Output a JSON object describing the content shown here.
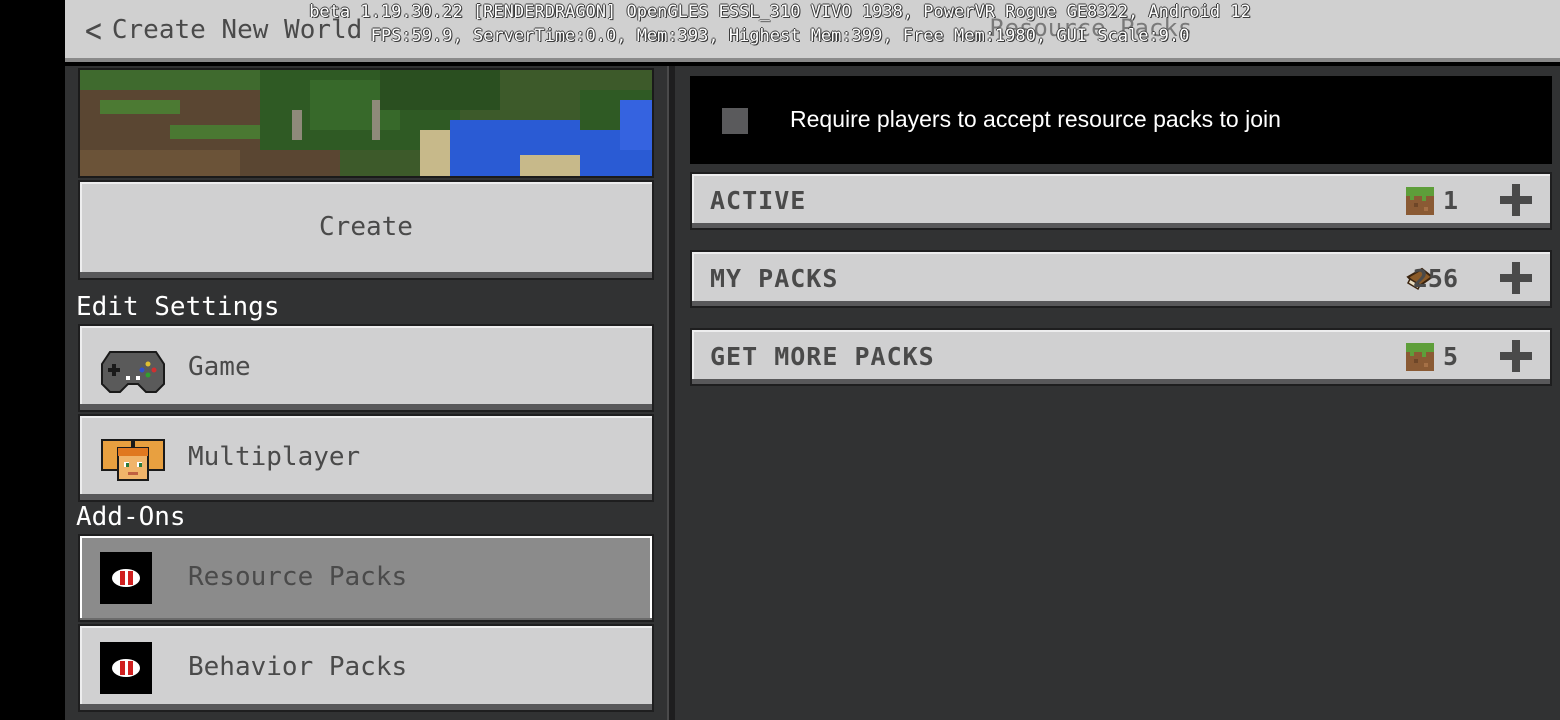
{
  "header": {
    "back_label": "Create New World",
    "panel_title": "Resource Packs"
  },
  "debug": {
    "line1": "beta 1.19.30.22 [RENDERDRAGON] OpenGLES ESSL_310 VIVO 1938, PowerVR Rogue GE8322, Android 12",
    "line2": "FPS:59.9, ServerTime:0.0, Mem:393, Highest Mem:399, Free Mem:1980, GUI Scale:9.0"
  },
  "left": {
    "create_label": "Create",
    "edit_settings_label": "Edit Settings",
    "game_label": "Game",
    "multiplayer_label": "Multiplayer",
    "addons_label": "Add-Ons",
    "resource_packs_label": "Resource Packs",
    "behavior_packs_label": "Behavior Packs"
  },
  "right": {
    "require_text": "Require players to accept resource packs to join",
    "require_checked": false,
    "sections": [
      {
        "title": "ACTIVE",
        "icon": "grass-block-icon",
        "count": "1"
      },
      {
        "title": "MY PACKS",
        "icon": "book-icon",
        "count": "256"
      },
      {
        "title": "GET MORE PACKS",
        "icon": "grass-block-icon",
        "count": "5"
      }
    ]
  },
  "colors": {
    "panel_bg": "#313233",
    "button_bg": "#d0d0d1",
    "selected_bg": "#8b8b8b",
    "text_dark": "#4a4a4a"
  }
}
